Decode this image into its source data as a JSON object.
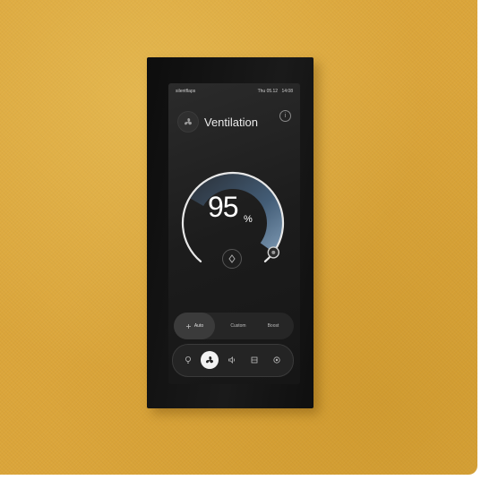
{
  "device": {
    "brand": "silentflaps",
    "status": {
      "day": "Thu 05.12",
      "time": "14:08"
    },
    "title": "Ventilation",
    "gauge": {
      "value": "95",
      "unit": "%",
      "level": 0.95
    },
    "presets": [
      {
        "label": "Auto",
        "active": true
      },
      {
        "label": "Custom",
        "active": false
      },
      {
        "label": "Boost",
        "active": false
      }
    ],
    "nav": [
      {
        "icon": "lightbulb-icon",
        "active": false
      },
      {
        "icon": "fan-icon",
        "active": true
      },
      {
        "icon": "speaker-icon",
        "active": false
      },
      {
        "icon": "window-icon",
        "active": false
      },
      {
        "icon": "settings-icon",
        "active": false
      }
    ]
  },
  "colors": {
    "wall": "#dba53a",
    "bezel": "#111111",
    "screen": "#1f1f1f",
    "accent_arc": "#6f8fb0"
  }
}
